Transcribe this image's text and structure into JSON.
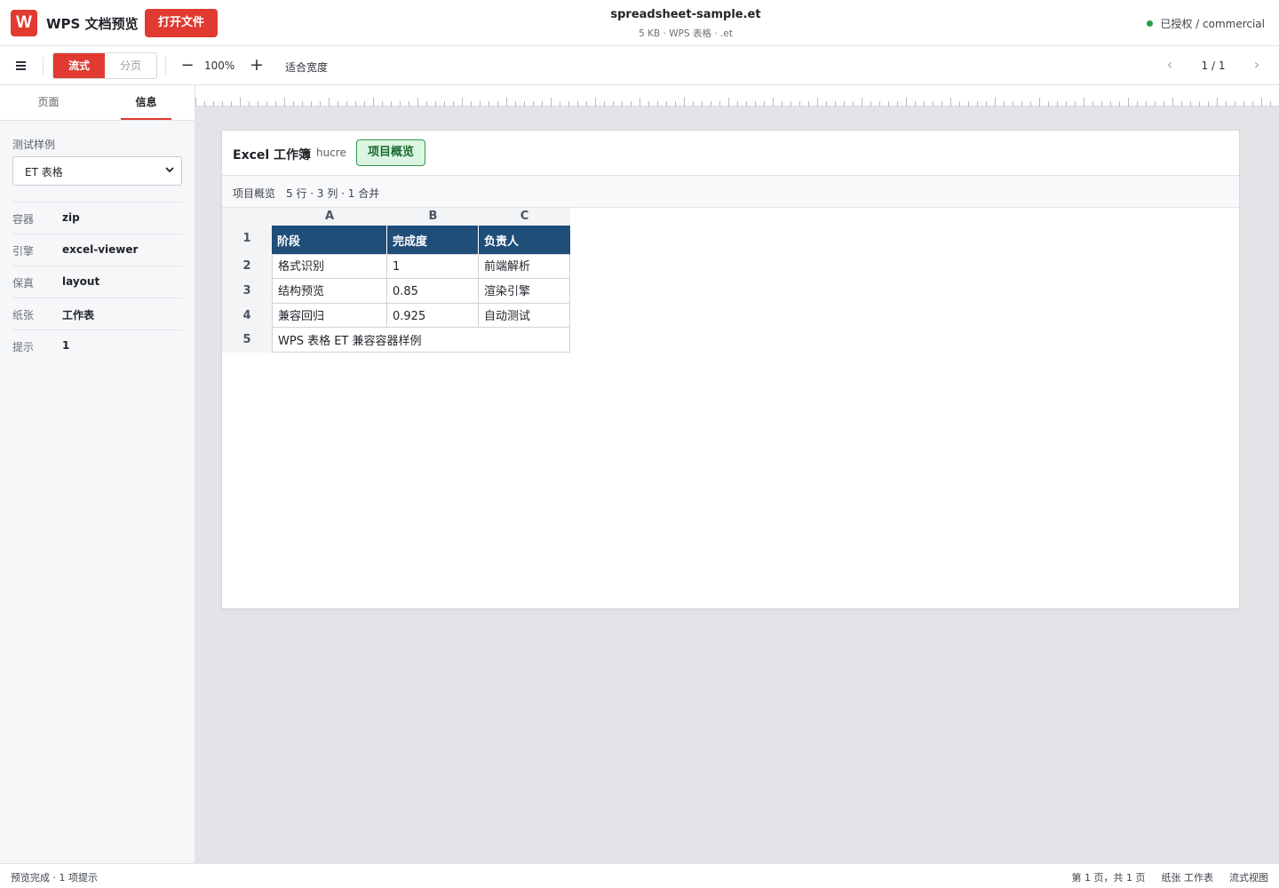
{
  "header": {
    "logo_letter": "W",
    "app_title": "WPS 文档预览",
    "open_button": "打开文件",
    "doc_name": "spreadsheet-sample.et",
    "doc_meta": "5 KB · WPS 表格 · .et",
    "license": "已授权 / commercial"
  },
  "toolbar": {
    "mode_flow": "流式",
    "mode_paged": "分页",
    "zoom_minus": "−",
    "zoom": "100%",
    "zoom_plus": "+",
    "fit_width": "适合宽度",
    "prev": "‹",
    "page_indicator": "1 / 1",
    "next": "›"
  },
  "sidebar": {
    "tabs": [
      "页面",
      "信息"
    ],
    "active_tab": "信息",
    "sample_label": "测试样例",
    "sample_value": "ET 表格",
    "info": [
      {
        "key": "容器",
        "value": "zip"
      },
      {
        "key": "引擎",
        "value": "excel-viewer"
      },
      {
        "key": "保真",
        "value": "layout"
      },
      {
        "key": "纸张",
        "value": "工作表"
      },
      {
        "key": "提示",
        "value": "1"
      }
    ]
  },
  "sheet": {
    "kind": "Excel 工作簿",
    "label": "hucre",
    "tab_name": "项目概览",
    "sub_name": "项目概览",
    "sub_stats": "5 行 · 3 列 · 1 合并",
    "columns": [
      "A",
      "B",
      "C"
    ],
    "rows": [
      {
        "num": "1",
        "cells": [
          "阶段",
          "完成度",
          "负责人"
        ]
      },
      {
        "num": "2",
        "cells": [
          "格式识别",
          "1",
          "前端解析"
        ]
      },
      {
        "num": "3",
        "cells": [
          "结构预览",
          "0.85",
          "渲染引擎"
        ]
      },
      {
        "num": "4",
        "cells": [
          "兼容回归",
          "0.925",
          "自动测试"
        ]
      },
      {
        "num": "5",
        "merged": "WPS 表格 ET 兼容容器样例"
      }
    ]
  },
  "status": {
    "left": "预览完成 · 1 项提示",
    "page": "第 1 页，共 1 页",
    "paper": "纸张 工作表",
    "view": "流式视图"
  },
  "colors": {
    "accent": "#e03a31",
    "header_fill": "#1f4e79",
    "tab_green_bg": "#dcf5e2",
    "license_dot": "#26a148"
  }
}
